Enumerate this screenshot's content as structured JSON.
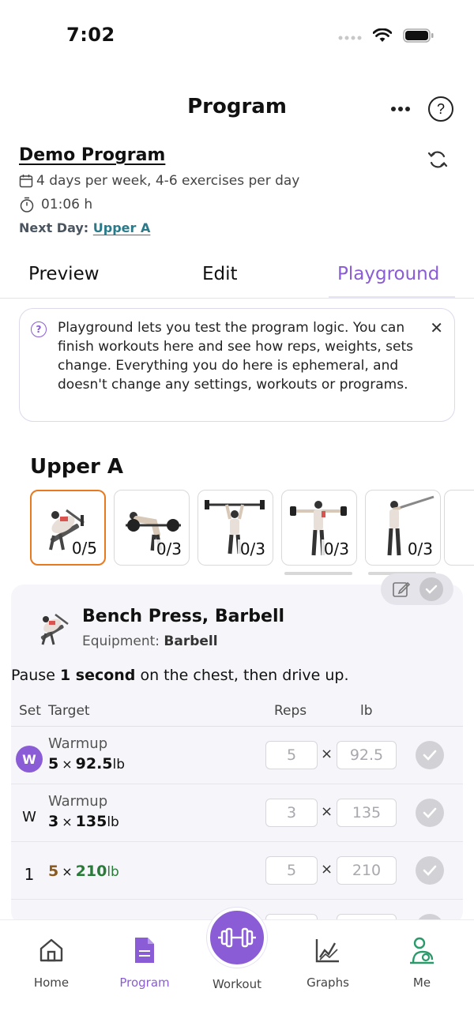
{
  "status": {
    "time": "7:02"
  },
  "header": {
    "title": "Program"
  },
  "program": {
    "name": "Demo Program",
    "schedule": "4 days per week, 4-6 exercises per day",
    "duration": "01:06 h",
    "next_day_label": "Next Day:",
    "next_day_value": "Upper A"
  },
  "tabs": [
    {
      "label": "Preview"
    },
    {
      "label": "Edit"
    },
    {
      "label": "Playground",
      "active": true
    }
  ],
  "help_card": {
    "text": "Playground lets you test the program logic. You can finish workouts here and see how reps, weights, sets change. Everything you do here is ephemeral, and doesn't change any settings, workouts or programs."
  },
  "day": {
    "title": "Upper A",
    "thumbnails": [
      {
        "icon": "bench-press-figure",
        "count": "0/5",
        "selected": true
      },
      {
        "icon": "bent-over-row-figure",
        "count": "0/3"
      },
      {
        "icon": "overhead-press-figure",
        "count": "0/3"
      },
      {
        "icon": "lateral-raise-figure",
        "count": "0/3"
      },
      {
        "icon": "landmine-press-figure",
        "count": "0/3"
      }
    ]
  },
  "exercise": {
    "name": "Bench Press, Barbell",
    "equipment_label": "Equipment:",
    "equipment_value": "Barbell",
    "note_prefix": "Pause",
    "note_bold": "1 second",
    "note_suffix": "on the chest, then drive up.",
    "columns": {
      "set": "Set",
      "target": "Target",
      "reps": "Reps",
      "weight": "lb"
    },
    "sets": [
      {
        "label": "W",
        "style": "badge",
        "type": "Warmup",
        "reps": "5",
        "weight": "92.5",
        "unit": "lb",
        "reps_placeholder": "5",
        "weight_placeholder": "92.5"
      },
      {
        "label": "W",
        "style": "plain",
        "type": "Warmup",
        "reps": "3",
        "weight": "135",
        "unit": "lb",
        "reps_placeholder": "3",
        "weight_placeholder": "135"
      },
      {
        "label": "1",
        "style": "plain",
        "type": "",
        "reps": "5",
        "weight": "210",
        "unit": "lb",
        "reps_placeholder": "5",
        "weight_placeholder": "210"
      }
    ]
  },
  "bottom_nav": [
    {
      "label": "Home",
      "icon": "home-icon"
    },
    {
      "label": "Program",
      "icon": "document-icon",
      "active": true
    },
    {
      "label": "Workout",
      "icon": "dumbbell-icon"
    },
    {
      "label": "Graphs",
      "icon": "chart-icon"
    },
    {
      "label": "Me",
      "icon": "person-icon"
    }
  ],
  "colors": {
    "accent": "#8a5cd6",
    "selected_border": "#e8791f",
    "link": "#2a7a8a",
    "reps_target": "#8a5a1e",
    "weight_target": "#2a7a3a"
  }
}
